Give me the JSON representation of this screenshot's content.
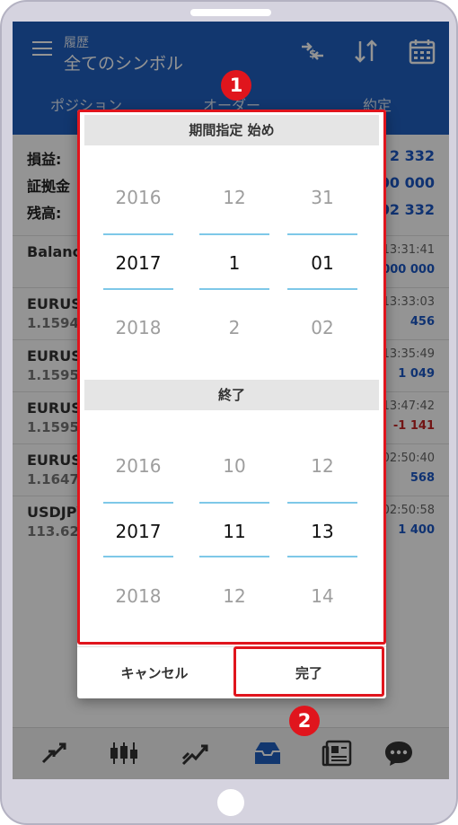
{
  "header": {
    "subtitle": "履歴",
    "title": "全てのシンボル",
    "icons": [
      "menu-icon",
      "symbol-swap-icon",
      "sort-icon",
      "calendar-icon"
    ]
  },
  "tabs": [
    {
      "label": "ポジション"
    },
    {
      "label": "オーダー"
    },
    {
      "label": "約定"
    }
  ],
  "summary": [
    {
      "label": "損益:",
      "value": "2 332"
    },
    {
      "label": "証拠金",
      "value": "00 000"
    },
    {
      "label": "残高:",
      "value": "02 332"
    }
  ],
  "deals": [
    {
      "symbol": "Balance",
      "price": "",
      "time": "13:31:41",
      "amount": "1 000 000"
    },
    {
      "symbol": "EURUSD",
      "price": "1.1594",
      "time": "13:33:03",
      "amount": "456"
    },
    {
      "symbol": "EURUSD",
      "price": "1.1595",
      "time": "13:35:49",
      "amount": "1 049"
    },
    {
      "symbol": "EURUSD",
      "price": "1.1595",
      "time": "13:47:42",
      "amount": "-1 141"
    },
    {
      "symbol": "EURUSD",
      "price": "1.1647",
      "time": "02:50:40",
      "amount": "568"
    },
    {
      "symbol": "USDJPY",
      "price": "113.62",
      "time": "02:50:58",
      "amount": "1 400"
    }
  ],
  "dialog": {
    "start_title": "期間指定 始め",
    "end_title": "終了",
    "start_picker": {
      "year": {
        "prev": "2016",
        "selected": "2017",
        "next": "2018"
      },
      "month": {
        "prev": "12",
        "selected": "1",
        "next": "2"
      },
      "day": {
        "prev": "31",
        "selected": "01",
        "next": "02"
      }
    },
    "end_picker": {
      "year": {
        "prev": "2016",
        "selected": "2017",
        "next": "2018"
      },
      "month": {
        "prev": "10",
        "selected": "11",
        "next": "12"
      },
      "day": {
        "prev": "12",
        "selected": "13",
        "next": "14"
      }
    },
    "cancel_label": "キャンセル",
    "done_label": "完了"
  },
  "callouts": {
    "first": "1",
    "second": "2"
  },
  "bottom_nav": [
    "quotes-icon",
    "chart-icon",
    "trade-icon",
    "history-icon",
    "news-icon",
    "chat-icon"
  ],
  "colors": {
    "accent": "#1f5fbf",
    "highlight": "#e0151d",
    "negative": "#c42424",
    "picker_line": "#7ec8e8"
  }
}
